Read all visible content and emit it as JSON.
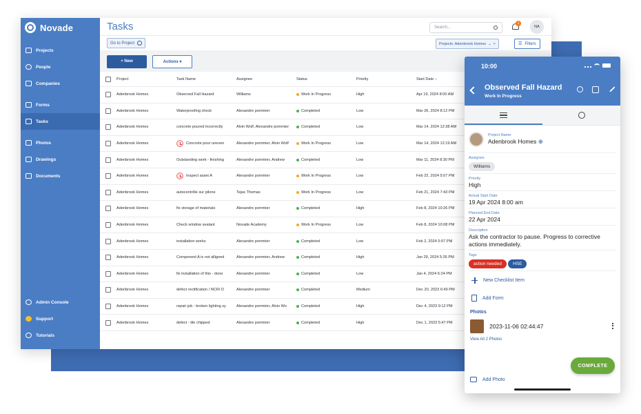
{
  "app": {
    "brand": "Novade",
    "page_title": "Tasks",
    "avatar_initials": "NA",
    "notification_count": "1",
    "accent": "#4a7dc4"
  },
  "sidebar": {
    "items": [
      {
        "label": "Projects",
        "icon": "folder-icon"
      },
      {
        "label": "People",
        "icon": "people-icon"
      },
      {
        "label": "Companies",
        "icon": "building-icon"
      },
      {
        "label": "Forms",
        "icon": "form-icon"
      },
      {
        "label": "Tasks",
        "icon": "task-list-icon"
      },
      {
        "label": "Photos",
        "icon": "photo-icon"
      },
      {
        "label": "Drawings",
        "icon": "drawing-icon"
      },
      {
        "label": "Documents",
        "icon": "document-icon"
      }
    ],
    "bottom": [
      {
        "label": "Admin Console",
        "icon": "gear-icon"
      },
      {
        "label": "Support",
        "icon": "support-icon"
      },
      {
        "label": "Tutorials",
        "icon": "play-icon"
      }
    ]
  },
  "header": {
    "search_placeholder": "Search...",
    "goto_label": "Go to Project",
    "project_filter": "Projects: Adenbrook Homes",
    "filters_label": "Filters"
  },
  "actions": {
    "new_label": "+ New",
    "actions_label": "Actions ▾"
  },
  "table": {
    "columns": [
      "Project",
      "Task Name",
      "Assignee",
      "Status",
      "Priority",
      "Start Date ↓"
    ],
    "rows": [
      {
        "project": "Adenbrook Homes",
        "task": "Observed Fall Hazard",
        "assignee": "Williams",
        "status": "Work In Progress",
        "priority": "High",
        "date": "Apr 19, 2024 8:00 AM",
        "overdue": false
      },
      {
        "project": "Adenbrook Homes",
        "task": "Waterproofing check",
        "assignee": "Alexandre pommier",
        "status": "Completed",
        "priority": "Low",
        "date": "Mar 26, 2024 8:12 PM",
        "overdue": false
      },
      {
        "project": "Adenbrook Homes",
        "task": "concrete poured incorrectly",
        "assignee": "Alvin Wolf, Alexandre pommier",
        "status": "Completed",
        "priority": "Low",
        "date": "Mar 14, 2024 12:38 AM",
        "overdue": false
      },
      {
        "project": "Adenbrook Homes",
        "task": "Concrete pour uneven",
        "assignee": "Alexandre pommier, Alvin Wolf",
        "status": "Work In Progress",
        "priority": "Low",
        "date": "Mar 14, 2024 12:19 AM",
        "overdue": true
      },
      {
        "project": "Adenbrook Homes",
        "task": "Outstanding work - finishing",
        "assignee": "Alexandre pommier, Andrew",
        "status": "Completed",
        "priority": "Low",
        "date": "Mar 11, 2024 8:30 PM",
        "overdue": false
      },
      {
        "project": "Adenbrook Homes",
        "task": "Inspect asset A",
        "assignee": "Alexandre pommier",
        "status": "Work In Progress",
        "priority": "Low",
        "date": "Feb 22, 2024 5:07 PM",
        "overdue": true
      },
      {
        "project": "Adenbrook Homes",
        "task": "autocontrôle sur pilone",
        "assignee": "Tejas Thomas",
        "status": "Work In Progress",
        "priority": "Low",
        "date": "Feb 21, 2024 7:43 PM",
        "overdue": false
      },
      {
        "project": "Adenbrook Homes",
        "task": "fix storage of materials",
        "assignee": "Alexandre pommier",
        "status": "Completed",
        "priority": "High",
        "date": "Feb 8, 2024 10:26 PM",
        "overdue": false
      },
      {
        "project": "Adenbrook Homes",
        "task": "Check window sealant",
        "assignee": "Novade Academy",
        "status": "Work In Progress",
        "priority": "Low",
        "date": "Feb 8, 2024 10:08 PM",
        "overdue": false
      },
      {
        "project": "Adenbrook Homes",
        "task": "installation works",
        "assignee": "Alexandre pommier",
        "status": "Completed",
        "priority": "Low",
        "date": "Feb 2, 2024 5:07 PM",
        "overdue": false
      },
      {
        "project": "Adenbrook Homes",
        "task": "Component A is not alligned",
        "assignee": "Alexandre pommier, Andrew",
        "status": "Completed",
        "priority": "High",
        "date": "Jan 29, 2024 5:26 PM",
        "overdue": false
      },
      {
        "project": "Adenbrook Homes",
        "task": "fix installation of this - done",
        "assignee": "Alexandre pommier",
        "status": "Completed",
        "priority": "Low",
        "date": "Jan 4, 2024 6:24 PM",
        "overdue": false
      },
      {
        "project": "Adenbrook Homes",
        "task": "defect rectification / NCR/ D",
        "assignee": "Alexandre pommier",
        "status": "Completed",
        "priority": "Medium",
        "date": "Dec 20, 2023 6:49 PM",
        "overdue": false
      },
      {
        "project": "Adenbrook Homes",
        "task": "repair job - broken lighting sy",
        "assignee": "Alexandre pommier, Alvin Wo",
        "status": "Completed",
        "priority": "High",
        "date": "Dec 4, 2023 9:12 PM",
        "overdue": false
      },
      {
        "project": "Adenbrook Homes",
        "task": "defect - tile chipped",
        "assignee": "Alexandre pommier",
        "status": "Completed",
        "priority": "High",
        "date": "Dec 1, 2023 5:47 PM",
        "overdue": false
      }
    ],
    "status_colors": {
      "Work In Progress": "#f5a623",
      "Completed": "#4caf50"
    }
  },
  "phone": {
    "time": "10:00",
    "title": "Observed Fall Hazard",
    "subtitle": "Work In Progress",
    "project_label": "Project Name",
    "project_value": "Adenbrook Homes",
    "assignee_label": "Assignee",
    "assignee_value": "Williams",
    "priority_label": "Priority",
    "priority_value": "High",
    "start_label": "Actual Start Date",
    "start_value": "19 Apr 2024 8:00 am",
    "end_label": "Planned End Date",
    "end_value": "22 Apr 2024",
    "desc_label": "Description",
    "desc_value": "Ask the contractor to pause. Progress to corrective actions immediately.",
    "tags_label": "Tags",
    "tags": [
      "action needed",
      "HSE"
    ],
    "new_checklist": "New Checklist Item",
    "add_form": "Add Form",
    "photos_label": "Photos",
    "photo_name": "2023-11-06 02:44:47",
    "view_all": "View All 2 Photos",
    "complete_label": "COMPLETE",
    "add_photo": "Add Photo"
  }
}
